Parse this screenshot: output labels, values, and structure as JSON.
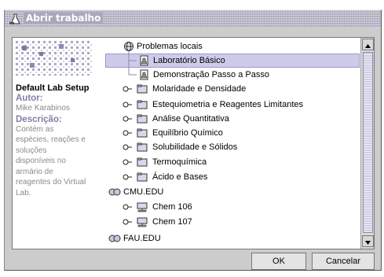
{
  "window": {
    "title": "Abrir trabalho"
  },
  "info": {
    "setup_name": "Default Lab Setup",
    "author_label": "Autor:",
    "author": "Mike Karabinos",
    "description_label": "Descrição:",
    "description_lines": [
      "Contém as",
      "espécies, reações e",
      "soluções",
      "disponíveis no",
      "armário de",
      "reagentes do Virtual",
      "Lab."
    ]
  },
  "tree": {
    "items": [
      {
        "label": "Problemas locais",
        "icon": "network-folder-icon"
      },
      {
        "label": "Laboratório Básico",
        "icon": "lab-document-icon",
        "selected": true
      },
      {
        "label": "Demonstração Passo a Passo",
        "icon": "lab-document-icon"
      },
      {
        "label": "Molaridade e Densidade",
        "icon": "folder-icon"
      },
      {
        "label": "Estequiometria e Reagentes Limitantes",
        "icon": "folder-icon"
      },
      {
        "label": "Análise Quantitativa",
        "icon": "folder-icon"
      },
      {
        "label": "Equilíbrio Químico",
        "icon": "folder-icon"
      },
      {
        "label": "Solubilidade e Sólidos",
        "icon": "folder-icon"
      },
      {
        "label": "Termoquímica",
        "icon": "folder-icon"
      },
      {
        "label": "Ácido e Bases",
        "icon": "folder-icon"
      },
      {
        "label": "CMU.EDU",
        "icon": "server-group-icon"
      },
      {
        "label": "Chem 106",
        "icon": "computer-icon"
      },
      {
        "label": "Chem 107",
        "icon": "computer-icon"
      },
      {
        "label": "FAU.EDU",
        "icon": "server-group-icon"
      }
    ]
  },
  "buttons": {
    "ok": "OK",
    "cancel": "Cancelar"
  }
}
